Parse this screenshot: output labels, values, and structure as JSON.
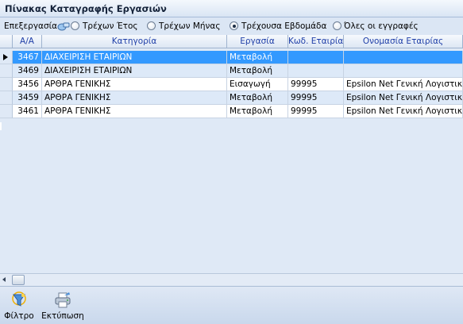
{
  "window": {
    "title": "Πίνακας Καταγραφής Εργασιών"
  },
  "options": {
    "edit_label": "Επεξεργασία",
    "radios": [
      {
        "label": "Τρέχων Έτος",
        "selected": false
      },
      {
        "label": "Τρέχων Μήνας",
        "selected": false
      },
      {
        "label": "Τρέχουσα Εβδομάδα",
        "selected": true
      },
      {
        "label": "Όλες οι εγγραφές",
        "selected": false
      }
    ]
  },
  "grid": {
    "columns": [
      "Α/Α",
      "Κατηγορία",
      "Εργασία",
      "Κωδ. Εταιρίας",
      "Ονομασία Εταιρίας"
    ],
    "rows": [
      {
        "aa": "3467",
        "category": "ΔΙΑΧΕΙΡΙΣΗ ΕΤΑΙΡΙΩΝ",
        "task": "Μεταβολή",
        "code": "",
        "company": ""
      },
      {
        "aa": "3469",
        "category": "ΔΙΑΧΕΙΡΙΣΗ ΕΤΑΙΡΙΩΝ",
        "task": "Μεταβολή",
        "code": "",
        "company": ""
      },
      {
        "aa": "3456",
        "category": "ΑΡΘΡΑ ΓΕΝΙΚΗΣ",
        "task": "Εισαγωγή",
        "code": "99995",
        "company": "Epsilon Net Γενική Λογιστική (Ν"
      },
      {
        "aa": "3459",
        "category": "ΑΡΘΡΑ ΓΕΝΙΚΗΣ",
        "task": "Μεταβολή",
        "code": "99995",
        "company": "Epsilon Net Γενική Λογιστική (Ν"
      },
      {
        "aa": "3461",
        "category": "ΑΡΘΡΑ ΓΕΝΙΚΗΣ",
        "task": "Μεταβολή",
        "code": "99995",
        "company": "Epsilon Net Γενική Λογιστική (Ν"
      }
    ]
  },
  "toolbar": {
    "filter_label": "Φίλτρο",
    "print_label": "Εκτύπωση"
  }
}
